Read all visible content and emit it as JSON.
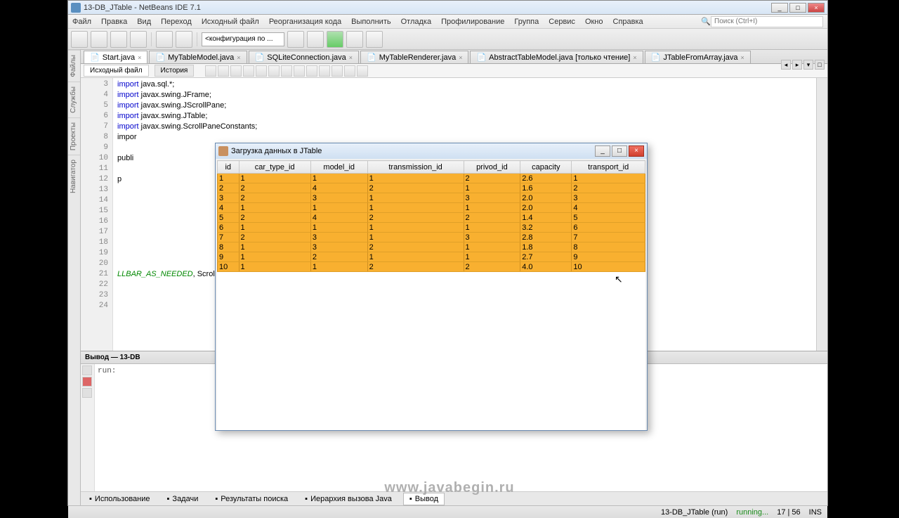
{
  "window": {
    "title": "13-DB_JTable - NetBeans IDE 7.1"
  },
  "menu": {
    "items": [
      "Файл",
      "Правка",
      "Вид",
      "Переход",
      "Исходный файл",
      "Реорганизация кода",
      "Выполнить",
      "Отладка",
      "Профилирование",
      "Группа",
      "Сервис",
      "Окно",
      "Справка"
    ],
    "search_placeholder": "Поиск (Ctrl+I)"
  },
  "toolbar": {
    "config": "<конфигурация по ..."
  },
  "left_tabs": [
    "Файлы",
    "Службы",
    "Проекты",
    "Навигатор"
  ],
  "file_tabs": [
    {
      "label": "Start.java",
      "active": true
    },
    {
      "label": "MyTableModel.java",
      "active": false
    },
    {
      "label": "SQLiteConnection.java",
      "active": false
    },
    {
      "label": "MyTableRenderer.java",
      "active": false
    },
    {
      "label": "AbstractTableModel.java [только чтение]",
      "active": false
    },
    {
      "label": "JTableFromArray.java",
      "active": false
    }
  ],
  "editor_tabs": {
    "source": "Исходный файл",
    "history": "История"
  },
  "code": {
    "line_start": 3,
    "lines": [
      "import java.sql.*;",
      "import javax.swing.JFrame;",
      "import javax.swing.JScrollPane;",
      "import javax.swing.JTable;",
      "import javax.swing.ScrollPaneConstants;",
      "impor",
      "",
      "publi",
      "",
      "    p",
      "",
      "",
      "",
      "",
      "",
      "",
      "",
      "",
      "                                                                                       LLBAR_AS_NEEDED, ScrollPaneConstants.HORIZONT",
      "",
      "",
      ""
    ]
  },
  "output": {
    "title": "Вывод — 13-DB",
    "text": "run:"
  },
  "bottom_tabs": [
    "Использование",
    "Задачи",
    "Результаты поиска",
    "Иерархия вызова Java",
    "Вывод"
  ],
  "dialog": {
    "title": "Загрузка данных в JTable",
    "columns": [
      "id",
      "car_type_id",
      "model_id",
      "transmission_id",
      "privod_id",
      "capacity",
      "transport_id"
    ],
    "rows": [
      [
        "1",
        "1",
        "1",
        "1",
        "2",
        "2.6",
        "1"
      ],
      [
        "2",
        "2",
        "4",
        "2",
        "1",
        "1.6",
        "2"
      ],
      [
        "3",
        "2",
        "3",
        "1",
        "3",
        "2.0",
        "3"
      ],
      [
        "4",
        "1",
        "1",
        "1",
        "1",
        "2.0",
        "4"
      ],
      [
        "5",
        "2",
        "4",
        "2",
        "2",
        "1.4",
        "5"
      ],
      [
        "6",
        "1",
        "1",
        "1",
        "1",
        "3.2",
        "6"
      ],
      [
        "7",
        "2",
        "3",
        "1",
        "3",
        "2.8",
        "7"
      ],
      [
        "8",
        "1",
        "3",
        "2",
        "1",
        "1.8",
        "8"
      ],
      [
        "9",
        "1",
        "2",
        "1",
        "1",
        "2.7",
        "9"
      ],
      [
        "10",
        "1",
        "1",
        "2",
        "2",
        "4.0",
        "10"
      ]
    ]
  },
  "watermark": "www.javabegin.ru",
  "status": {
    "project": "13-DB_JTable (run)",
    "state": "running...",
    "pos": "17 | 56",
    "ins": "INS"
  }
}
